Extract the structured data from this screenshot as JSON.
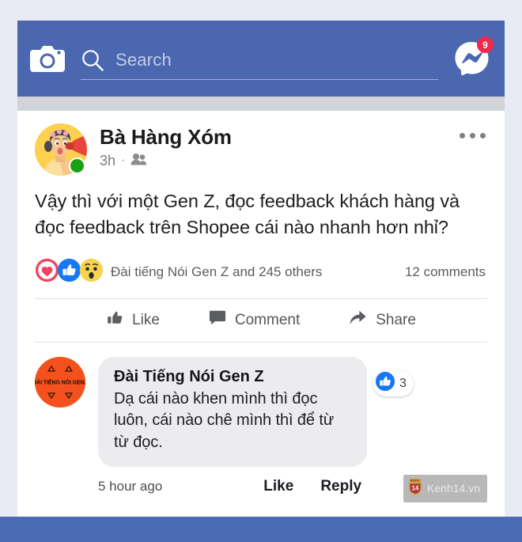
{
  "header": {
    "camera_icon": "camera-icon",
    "search": {
      "icon": "search-icon",
      "placeholder": "Search",
      "value": ""
    },
    "messenger": {
      "icon": "messenger-icon",
      "badge_count": "9"
    },
    "background_color": "#4a67b0"
  },
  "post": {
    "author": {
      "name": "Bà Hàng Xóm",
      "avatar_icon": "avatar-woman-megaphone",
      "online": true
    },
    "timestamp": "3h",
    "separator": "·",
    "audience_icon": "friends-icon",
    "more_icon": "more-options-icon",
    "text": "Vậy thì với một Gen Z, đọc feedback khách hàng và đọc feedback trên Shopee cái nào nhanh hơn nhỉ?",
    "reactions": {
      "icons": [
        "love-icon",
        "like-icon",
        "wow-icon"
      ],
      "summary": "Đài tiếng Nói Gen Z and 245 others",
      "comments_count": "12 comments",
      "colors": {
        "love": "#f3425f",
        "like": "#1778f2",
        "wow": "#f7d34e"
      }
    },
    "actions": [
      {
        "icon": "thumbs-up-icon",
        "label": "Like"
      },
      {
        "icon": "comment-bubble-icon",
        "label": "Comment"
      },
      {
        "icon": "share-arrow-icon",
        "label": "Share"
      }
    ]
  },
  "comment": {
    "author": {
      "name": "Đài Tiếng Nói Gen Z",
      "avatar_icon": "avatar-dai-tieng-noi-genz",
      "avatar_text": "ĐÀI TIẾNG NÓI GENZ",
      "avatar_color": "#f4511e"
    },
    "text": "Dạ cái nào khen mình thì đọc luôn, cái nào chê mình thì để từ từ đọc.",
    "reaction": {
      "icon": "like-icon",
      "count": "3"
    },
    "time": "5 hour ago",
    "like_label": "Like",
    "reply_label": "Reply"
  },
  "watermark": {
    "logo_icon": "kenh14-logo-icon",
    "logo_number": "14",
    "text": "Kenh14.vn"
  }
}
